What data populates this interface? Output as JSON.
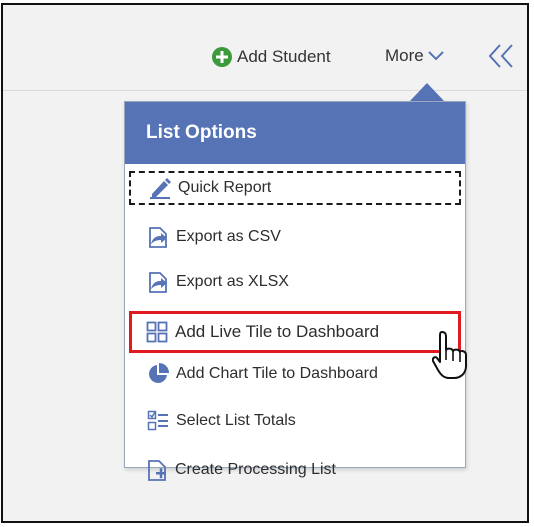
{
  "toolbar": {
    "add_student_label": "Add Student",
    "more_label": "More",
    "icons": {
      "add": "plus-circle-icon",
      "more": "chevron-down-icon",
      "collapse": "double-chevron-left-icon"
    },
    "colors": {
      "add_icon": "#3c9a3c",
      "chevrons": "#5673b5"
    }
  },
  "menu": {
    "title": "List Options",
    "header_color": "#5673b5",
    "items": [
      {
        "label": "Quick Report",
        "icon": "edit-report-icon",
        "state": "focused"
      },
      {
        "label": "Export as CSV",
        "icon": "export-arrow-icon"
      },
      {
        "label": "Export as XLSX",
        "icon": "export-arrow-icon"
      },
      {
        "label": "Add Live Tile to Dashboard",
        "icon": "grid-tiles-icon",
        "state": "highlighted"
      },
      {
        "label": "Add Chart Tile to Dashboard",
        "icon": "pie-chart-icon"
      },
      {
        "label": "Select List Totals",
        "icon": "checklist-icon"
      },
      {
        "label": "Create Processing List",
        "icon": "new-document-icon"
      }
    ]
  }
}
